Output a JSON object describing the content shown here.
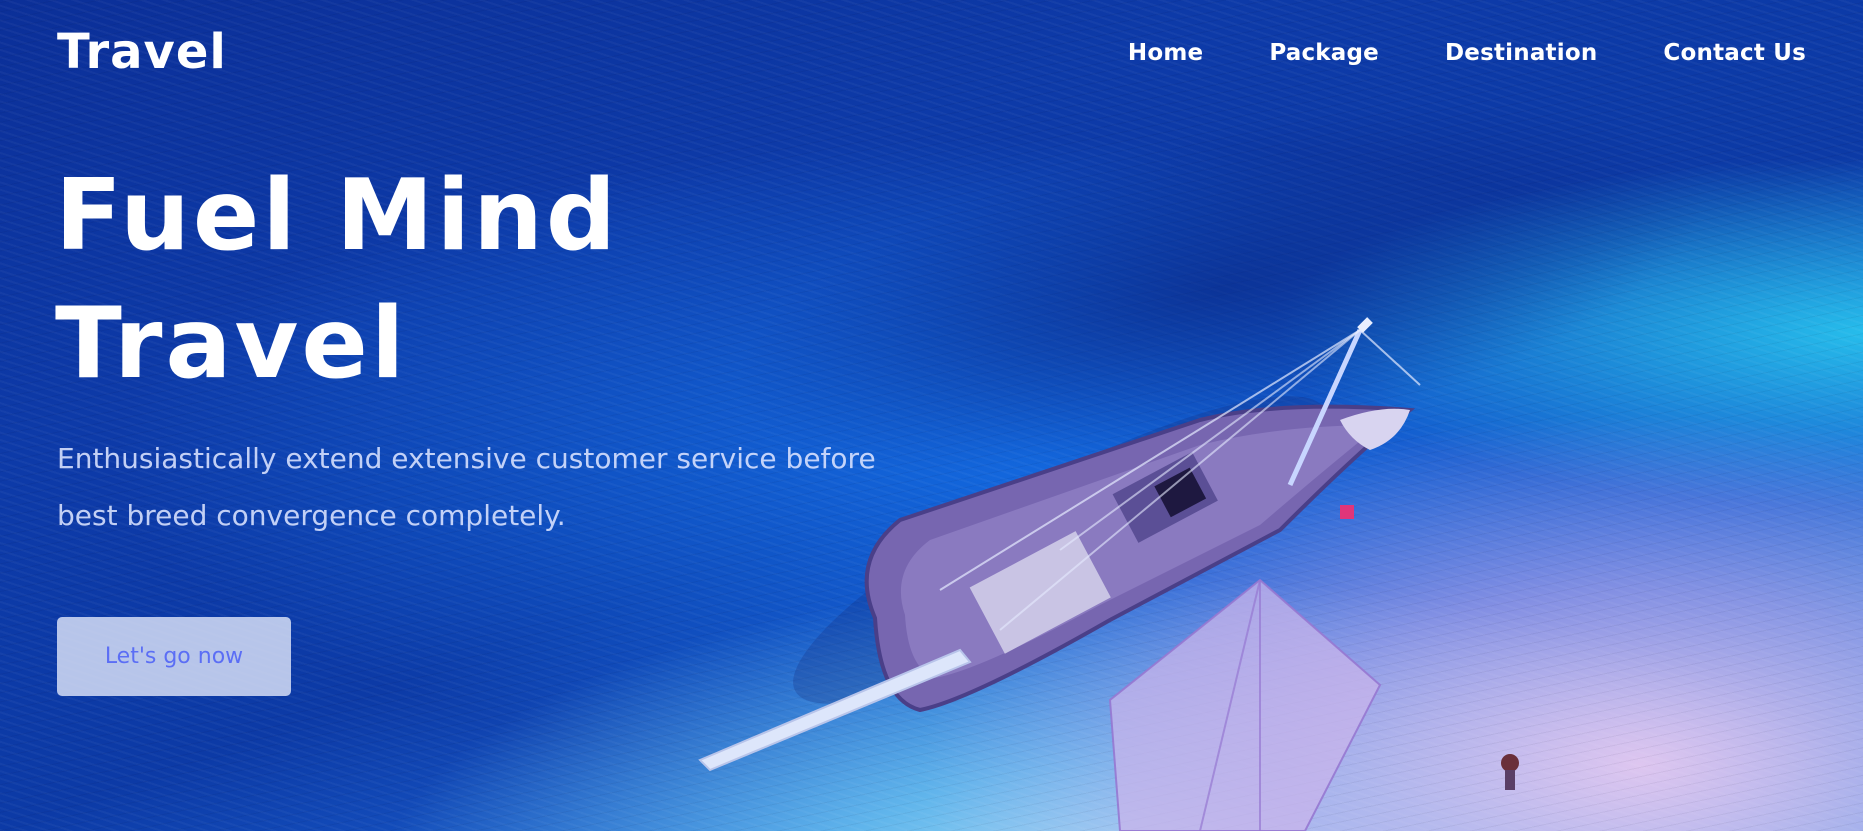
{
  "brand": {
    "logo_text": "Travel"
  },
  "nav": {
    "items": [
      {
        "label": "Home"
      },
      {
        "label": "Package"
      },
      {
        "label": "Destination"
      },
      {
        "label": "Contact Us"
      }
    ]
  },
  "hero": {
    "headline_line1": "Fuel Mind",
    "headline_line2": "Travel",
    "subtext_line1": "Enthusiastically extend extensive customer service before",
    "subtext_line2": "best breed convergence completely.",
    "cta_label": "Let's go now"
  },
  "colors": {
    "deep_water": "#0b2f98",
    "shallow_water": "#3aa7e8",
    "sand_tint": "#e6c8f0",
    "cta_background": "#d6def6",
    "cta_text": "#5b6ef5",
    "text": "#ffffff"
  },
  "icons": {
    "boat": "sailing-boat-illustration"
  }
}
